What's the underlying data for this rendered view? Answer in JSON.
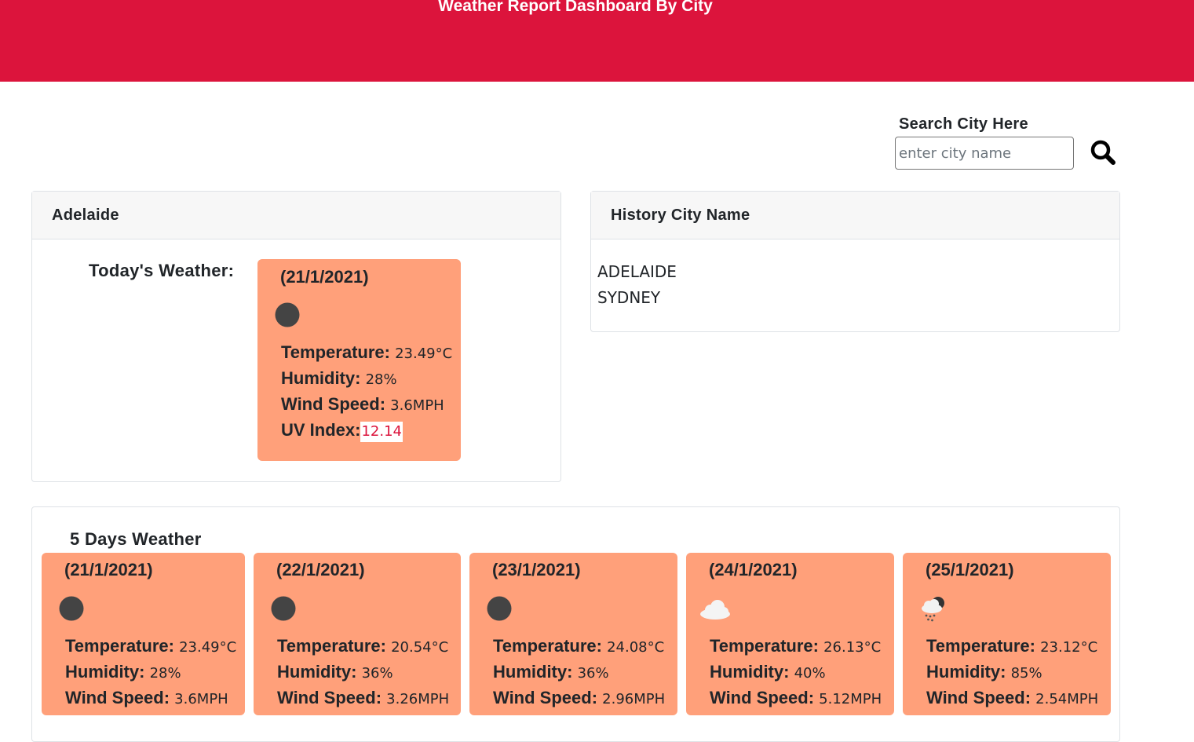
{
  "header": {
    "title": "Weather Report Dashboard By City"
  },
  "search": {
    "label": "Search City Here",
    "placeholder": "enter city name",
    "value": ""
  },
  "current": {
    "city": "Adelaide",
    "today_label": "Today's Weather:",
    "date": "(21/1/2021)",
    "icon": "moon-icon",
    "temperature_label": "Temperature:",
    "temperature": "23.49°C",
    "humidity_label": "Humidity:",
    "humidity": "28%",
    "wind_label": "Wind Speed:",
    "wind": "3.6MPH",
    "uv_label": "UV Index:",
    "uv": "12.14"
  },
  "history": {
    "title": "History City Name",
    "cities": [
      "ADELAIDE",
      "SYDNEY"
    ]
  },
  "forecast": {
    "title": "5 Days Weather",
    "temperature_label": "Temperature:",
    "humidity_label": "Humidity:",
    "wind_label": "Wind Speed:",
    "days": [
      {
        "date": "(21/1/2021)",
        "icon": "moon-icon",
        "temperature": "23.49°C",
        "humidity": "28%",
        "wind": "3.6MPH"
      },
      {
        "date": "(22/1/2021)",
        "icon": "moon-icon",
        "temperature": "20.54°C",
        "humidity": "36%",
        "wind": "3.26MPH"
      },
      {
        "date": "(23/1/2021)",
        "icon": "moon-icon",
        "temperature": "24.08°C",
        "humidity": "36%",
        "wind": "2.96MPH"
      },
      {
        "date": "(24/1/2021)",
        "icon": "cloud-icon",
        "temperature": "26.13°C",
        "humidity": "40%",
        "wind": "5.12MPH"
      },
      {
        "date": "(25/1/2021)",
        "icon": "rain-cloud-night-icon",
        "temperature": "23.12°C",
        "humidity": "85%",
        "wind": "2.54MPH"
      }
    ]
  },
  "colors": {
    "header": "#dc143c",
    "card": "#ffa07a",
    "uv_text": "#dc143c"
  }
}
